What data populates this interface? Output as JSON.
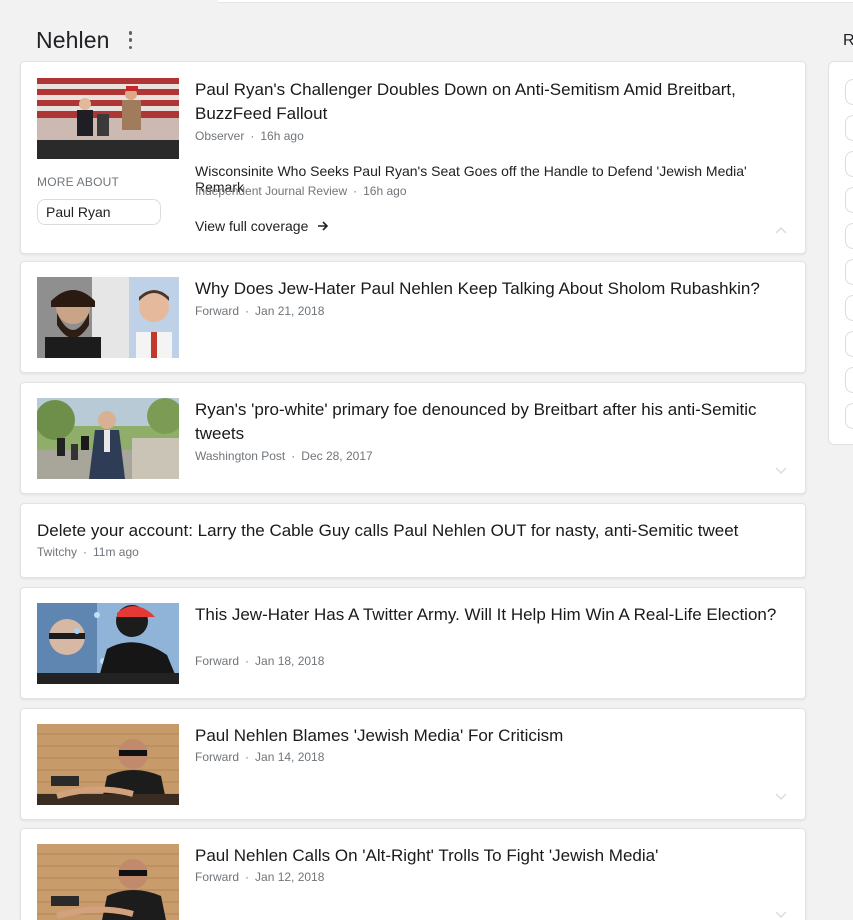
{
  "section": {
    "title": "Nehlen"
  },
  "right_panel": {
    "heading": "R"
  },
  "lead_story": {
    "headline": "Paul Ryan's Challenger Doubles Down on Anti-Semitism Amid Breitbart, BuzzFeed Fallout",
    "source": "Observer",
    "time": "16h ago",
    "sub_headline": "Wisconsinite Who Seeks Paul Ryan's Seat Goes off the Handle to Defend 'Jewish Media' Remark",
    "sub_source": "Independent Journal Review",
    "sub_time": "16h ago",
    "more_about_label": "MORE ABOUT",
    "chip_label": "Paul Ryan",
    "full_coverage_label": "View full coverage"
  },
  "stories": [
    {
      "headline": "Why Does Jew-Hater Paul Nehlen Keep Talking About Sholom Rubashkin?",
      "source": "Forward",
      "time": "Jan 21, 2018"
    },
    {
      "headline": "Ryan's 'pro-white' primary foe denounced by Breitbart after his anti-Semitic tweets",
      "source": "Washington Post",
      "time": "Dec 28, 2017"
    },
    {
      "headline": "Delete your account: Larry the Cable Guy calls Paul Nehlen OUT for nasty, anti-Semitic tweet",
      "source": "Twitchy",
      "time": "11m ago"
    },
    {
      "headline": "This Jew-Hater Has A Twitter Army. Will It Help Him Win A Real-Life Election?",
      "source": "Forward",
      "time": "Jan 18, 2018"
    },
    {
      "headline": "Paul Nehlen Blames 'Jewish Media' For Criticism",
      "source": "Forward",
      "time": "Jan 14, 2018"
    },
    {
      "headline": "Paul Nehlen Calls On 'Alt-Right' Trolls To Fight 'Jewish Media'",
      "source": "Forward",
      "time": "Jan 12, 2018"
    }
  ],
  "separator": "·",
  "icons": {
    "more": "more-vert-icon",
    "arrow": "arrow-right-icon",
    "chevron_up": "chevron-up-icon",
    "chevron_down": "chevron-down-icon"
  },
  "colors": {
    "background": "#f2f2f2",
    "card": "#ffffff",
    "meta_text": "#70757a",
    "headline_text": "#1a1a1a"
  }
}
